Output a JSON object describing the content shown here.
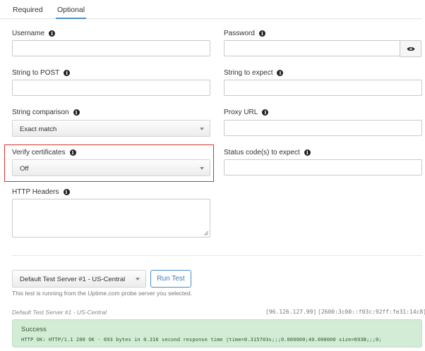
{
  "tabs": [
    {
      "label": "Required",
      "active": false
    },
    {
      "label": "Optional",
      "active": true
    }
  ],
  "form": {
    "username": {
      "label": "Username",
      "value": ""
    },
    "password": {
      "label": "Password",
      "value": ""
    },
    "string_to_post": {
      "label": "String to POST",
      "value": ""
    },
    "string_to_expect": {
      "label": "String to expect",
      "value": ""
    },
    "string_comparison": {
      "label": "String comparison",
      "value": "Exact match"
    },
    "proxy_url": {
      "label": "Proxy URL",
      "value": ""
    },
    "verify_certificates": {
      "label": "Verify certificates",
      "value": "Off"
    },
    "status_codes": {
      "label": "Status code(s) to expect",
      "value": ""
    },
    "http_headers": {
      "label": "HTTP Headers",
      "value": ""
    }
  },
  "test": {
    "server_select": "Default Test Server #1 - US-Central",
    "run_button": "Run Test",
    "helper_text": "This test is running from the Uptime.com probe server you selected."
  },
  "result": {
    "server": "Default Test Server #1 - US-Central",
    "ipv4": "[96.126.127.99]",
    "ipv6": "[2600:3c00::f03c:92ff:fe31:14c8]",
    "status": "Success",
    "message": "HTTP OK: HTTP/1.1 200 OK - 693 bytes in 0.316 second response time |time=0.315703s;;;0.000000;40.000000 size=693B;;;0;"
  },
  "colors": {
    "accent": "#4a90c8",
    "highlight": "#d9302e",
    "success_bg": "#d3ecd5"
  }
}
